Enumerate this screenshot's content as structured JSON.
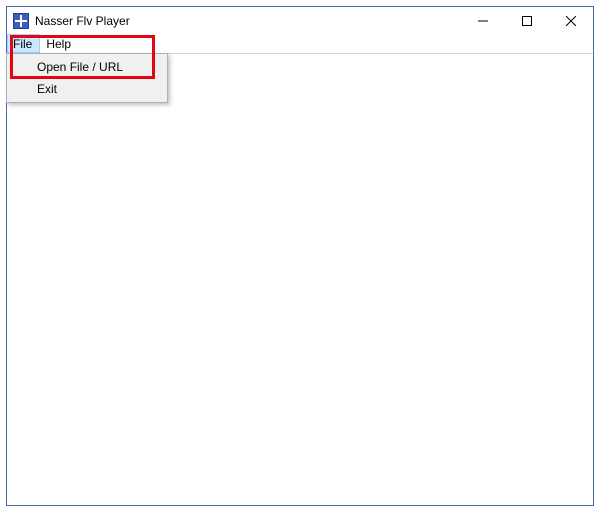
{
  "window": {
    "title": "Nasser Flv Player"
  },
  "menubar": {
    "file": "File",
    "help": "Help"
  },
  "file_menu": {
    "open": "Open File / URL",
    "exit": "Exit"
  }
}
